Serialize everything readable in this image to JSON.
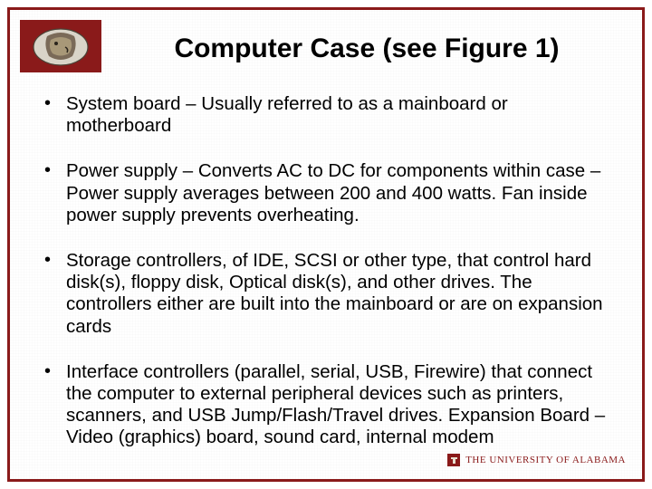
{
  "title": "Computer Case (see Figure 1)",
  "bullets": [
    "System board – Usually referred to as a mainboard or motherboard",
    "Power supply – Converts AC to DC for components within case – Power supply averages between 200 and 400 watts. Fan inside power supply prevents overheating.",
    "Storage controllers, of IDE, SCSI or other type, that control hard disk(s), floppy disk, Optical disk(s), and other drives. The controllers either are built into the mainboard or are on expansion cards",
    "Interface controllers (parallel, serial, USB, Firewire) that connect the computer to external peripheral devices such as printers, scanners, and USB Jump/Flash/Travel drives. Expansion Board – Video (graphics) board, sound card, internal modem"
  ],
  "footer": "THE UNIVERSITY OF ALABAMA"
}
